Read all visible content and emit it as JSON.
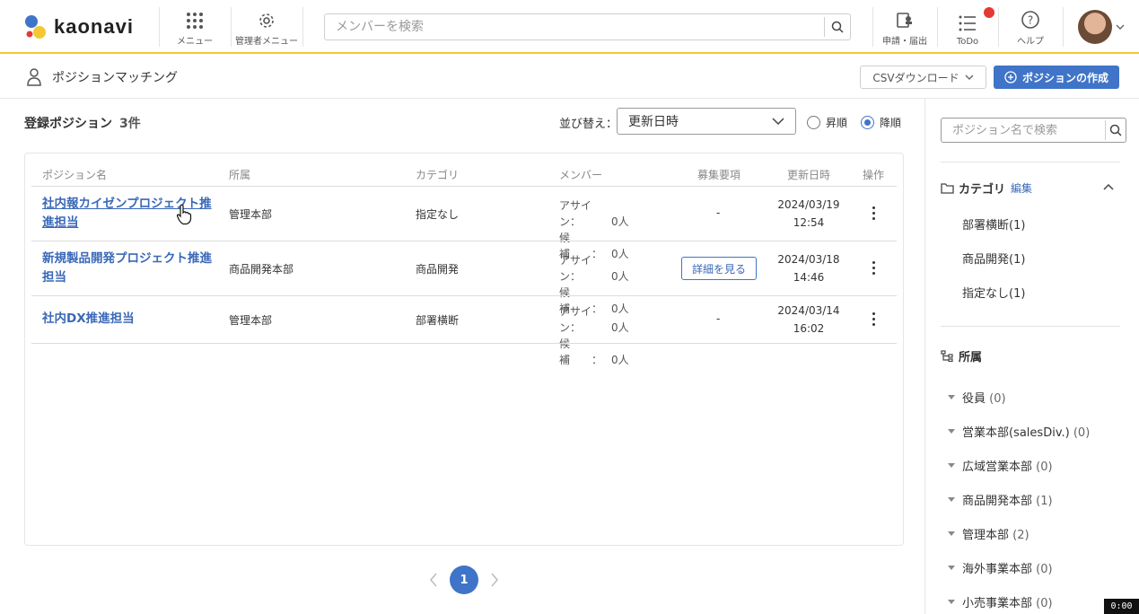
{
  "header": {
    "brand": "kaonavi",
    "menu_label": "メニュー",
    "admin_menu_label": "管理者メニュー",
    "search_placeholder": "メンバーを検索",
    "apply_label": "申請・届出",
    "todo_label": "ToDo",
    "help_label": "ヘルプ"
  },
  "subheader": {
    "title": "ポジションマッチング",
    "csv_label": "CSVダウンロード",
    "create_label": "ポジションの作成"
  },
  "list": {
    "heading": "登録ポジション",
    "count": "3件",
    "sort_label": "並び替え：",
    "sort_value": "更新日時",
    "asc_label": "昇順",
    "desc_label": "降順",
    "columns": [
      "ポジション名",
      "所属",
      "カテゴリ",
      "メンバー",
      "募集要項",
      "更新日時",
      "操作"
    ],
    "rows": [
      {
        "name": "社内報カイゼンプロジェクト推進担当",
        "dept": "管理本部",
        "category": "指定なし",
        "assign_label": "アサイン：",
        "assign": "0人",
        "cand_label": "候補　　：",
        "cand": "0人",
        "req": "-",
        "date": "2024/03/19",
        "time": "12:54"
      },
      {
        "name": "新規製品開発プロジェクト推進担当",
        "dept": "商品開発本部",
        "category": "商品開発",
        "assign_label": "アサイン：",
        "assign": "0人",
        "cand_label": "候補　　：",
        "cand": "0人",
        "req": "詳細を見る",
        "date": "2024/03/18",
        "time": "14:46"
      },
      {
        "name": "社内DX推進担当",
        "dept": "管理本部",
        "category": "部署横断",
        "assign_label": "アサイン：",
        "assign": "0人",
        "cand_label": "候補　　：",
        "cand": "0人",
        "req": "-",
        "date": "2024/03/14",
        "time": "16:02"
      }
    ],
    "page": "1"
  },
  "sidebar": {
    "search_placeholder": "ポジション名で検索",
    "category_heading": "カテゴリ",
    "edit_label": "編集",
    "categories": [
      "部署横断(1)",
      "商品開発(1)",
      "指定なし(1)"
    ],
    "org_heading": "所属",
    "orgs": [
      {
        "name": "役員",
        "count": "(0)"
      },
      {
        "name": "営業本部(salesDiv.)",
        "count": "(0)"
      },
      {
        "name": "広域営業本部",
        "count": "(0)"
      },
      {
        "name": "商品開発本部",
        "count": "(1)"
      },
      {
        "name": "管理本部",
        "count": "(2)"
      },
      {
        "name": "海外事業本部",
        "count": "(0)"
      },
      {
        "name": "小売事業本部",
        "count": "(0)"
      }
    ]
  },
  "timer": "0:00",
  "colors": {
    "accent": "#3f74c8",
    "brand_yellow": "#f4c832",
    "notify": "#e53935"
  }
}
